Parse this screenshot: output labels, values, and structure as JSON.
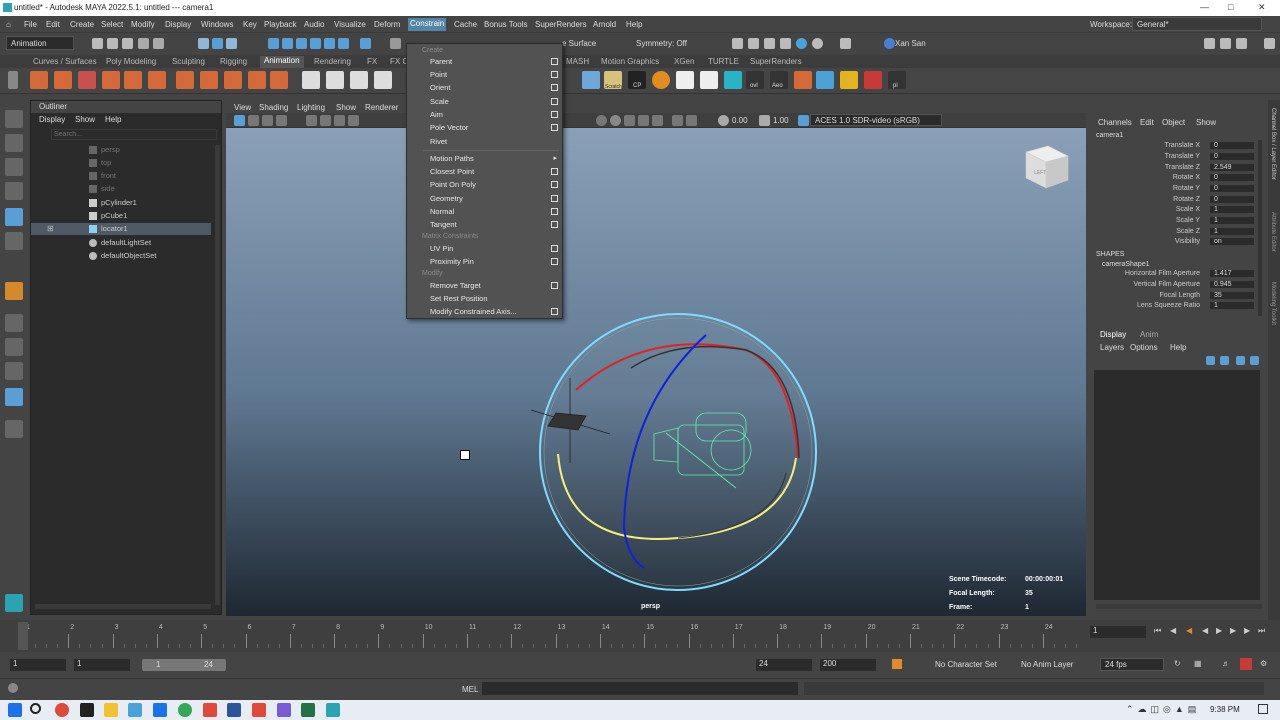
{
  "window": {
    "title": "untitled* - Autodesk MAYA 2022.5.1: untitled   ---   camera1"
  },
  "menus": [
    "File",
    "Edit",
    "Create",
    "Select",
    "Modify",
    "Display",
    "Windows",
    "Key",
    "Playback",
    "Audio",
    "Visualize",
    "Deform",
    "Constrain",
    "Cache",
    "Bonus Tools",
    "SuperRenders",
    "Arnold",
    "Help"
  ],
  "workspace": {
    "label": "Workspace:",
    "value": "General*"
  },
  "statusline": {
    "mode": "Animation",
    "surface": "e Surface",
    "symmetry": "Symmetry: Off",
    "user": "Xan San"
  },
  "shelf_tabs": [
    "Curves / Surfaces",
    "Poly Modeling",
    "Sculpting",
    "Rigging",
    "Animation",
    "Rendering",
    "FX",
    "FX C",
    "MASH",
    "Motion Graphics",
    "XGen",
    "TURTLE",
    "SuperRenders"
  ],
  "shelf_labels": [
    "Scratch",
    "CP",
    "ovl",
    "Aeo",
    "pl"
  ],
  "outliner": {
    "title": "Outliner",
    "menu": [
      "Display",
      "Show",
      "Help"
    ],
    "search_placeholder": "Search...",
    "items": [
      {
        "label": "persp",
        "dim": true
      },
      {
        "label": "top",
        "dim": true
      },
      {
        "label": "front",
        "dim": true
      },
      {
        "label": "side",
        "dim": true
      },
      {
        "label": "pCylinder1",
        "dim": false
      },
      {
        "label": "pCube1",
        "dim": false
      },
      {
        "label": "locator1",
        "dim": false,
        "selected": true
      },
      {
        "label": "defaultLightSet",
        "dim": false
      },
      {
        "label": "defaultObjectSet",
        "dim": false
      }
    ]
  },
  "viewport": {
    "menu": [
      "View",
      "Shading",
      "Lighting",
      "Show",
      "Renderer"
    ],
    "exposure": "0.00",
    "gamma": "1.00",
    "colorspace": "ACES 1.0 SDR-video (sRGB)",
    "camera_label": "persp",
    "cube_label": "LEFT",
    "hud": {
      "scene_timecode_label": "Scene Timecode:",
      "scene_timecode": "00:00:00:01",
      "focal_length_label": "Focal Length:",
      "focal_length": "35",
      "frame_label": "Frame:",
      "frame": "1"
    }
  },
  "constrain_menu": {
    "create_header": "Create",
    "items_a": [
      "Parent",
      "Point",
      "Orient",
      "Scale",
      "Aim",
      "Pole Vector",
      "Rivet"
    ],
    "items_b": [
      "Motion Paths",
      "Closest Point",
      "Point On Poly",
      "Geometry",
      "Normal",
      "Tangent"
    ],
    "matrix_header": "Matrix Constraints",
    "items_c": [
      "UV Pin",
      "Proximity Pin"
    ],
    "modify_header": "Modify",
    "items_d": [
      "Remove Target",
      "Set Rest Position",
      "Modify Constrained Axis..."
    ]
  },
  "channelbox": {
    "menu": [
      "Channels",
      "Edit",
      "Object",
      "Show"
    ],
    "object": "camera1",
    "attrs": [
      [
        "Translate X",
        "0"
      ],
      [
        "Translate Y",
        "0"
      ],
      [
        "Translate Z",
        "2.549"
      ],
      [
        "Rotate X",
        "0"
      ],
      [
        "Rotate Y",
        "0"
      ],
      [
        "Rotate Z",
        "0"
      ],
      [
        "Scale X",
        "1"
      ],
      [
        "Scale Y",
        "1"
      ],
      [
        "Scale Z",
        "1"
      ],
      [
        "Visibility",
        "on"
      ]
    ],
    "shapes_label": "SHAPES",
    "shape_name": "cameraShape1",
    "shape_attrs": [
      [
        "Horizontal Film Aperture",
        "1.417"
      ],
      [
        "Vertical Film Aperture",
        "0.945"
      ],
      [
        "Focal Length",
        "35"
      ],
      [
        "Lens Squeeze Ratio",
        "1"
      ]
    ],
    "tabs": [
      "Display",
      "Anim"
    ],
    "layer_menu": [
      "Layers",
      "Options",
      "Help"
    ],
    "side_tabs": [
      "Channel Box / Layer Editor",
      "Attribute Editor",
      "Modeling Toolkit"
    ]
  },
  "timeline": {
    "ticks": [
      "1",
      "2",
      "3",
      "4",
      "5",
      "6",
      "7",
      "8",
      "9",
      "10",
      "11",
      "12",
      "13",
      "14",
      "15",
      "16",
      "17",
      "18",
      "19",
      "20",
      "21",
      "22",
      "23",
      "24"
    ],
    "current": "1"
  },
  "range": {
    "start": "1",
    "start2": "1",
    "inner_start": "1",
    "inner_end": "24",
    "end": "24",
    "end2": "200",
    "char_set": "No Character Set",
    "anim_layer": "No Anim Layer",
    "fps": "24 fps"
  },
  "cmdline": {
    "label": "MEL"
  },
  "taskbar": {
    "time": "9:38 PM"
  }
}
